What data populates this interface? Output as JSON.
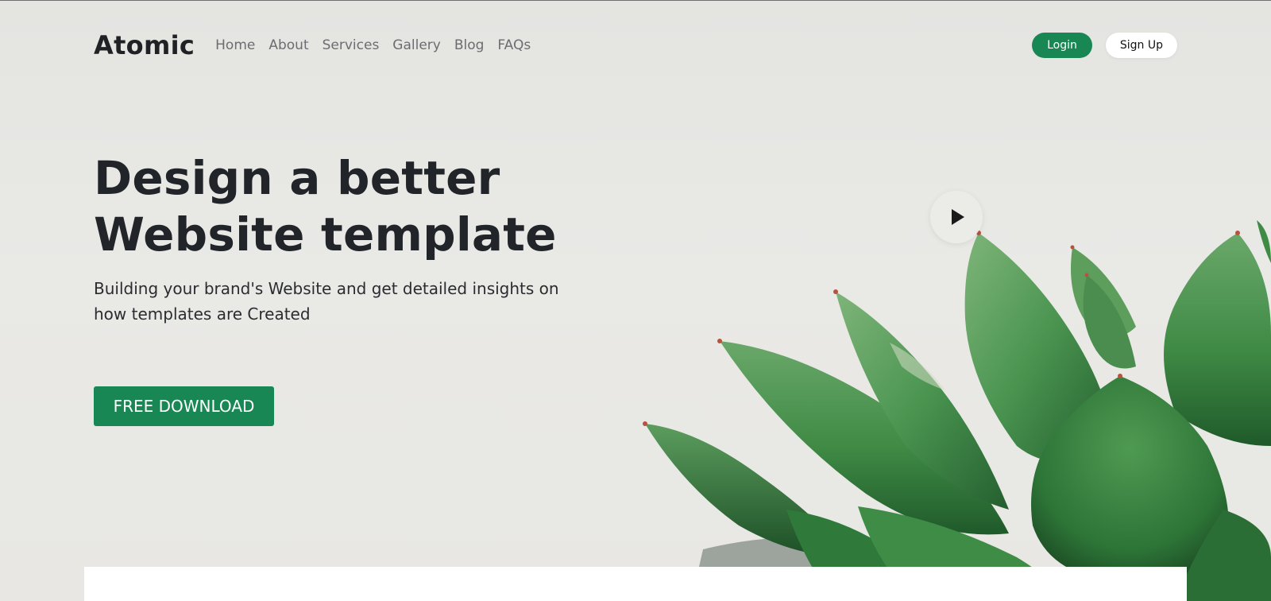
{
  "brand": {
    "logo": "Atomic"
  },
  "nav": {
    "items": [
      {
        "label": "Home"
      },
      {
        "label": "About"
      },
      {
        "label": "Services"
      },
      {
        "label": "Gallery"
      },
      {
        "label": "Blog"
      },
      {
        "label": "FAQs"
      }
    ]
  },
  "auth": {
    "login_label": "Login",
    "signup_label": "Sign Up"
  },
  "hero": {
    "title_line1": "Design a better",
    "title_line2": "Website template",
    "subtitle": "Building your brand's Website and get detailed insights on how templates are Created",
    "cta_label": "FREE DOWNLOAD",
    "play_icon": "play-icon"
  },
  "colors": {
    "accent": "#198754",
    "heading": "#212428",
    "background": "#e8e8e5"
  }
}
